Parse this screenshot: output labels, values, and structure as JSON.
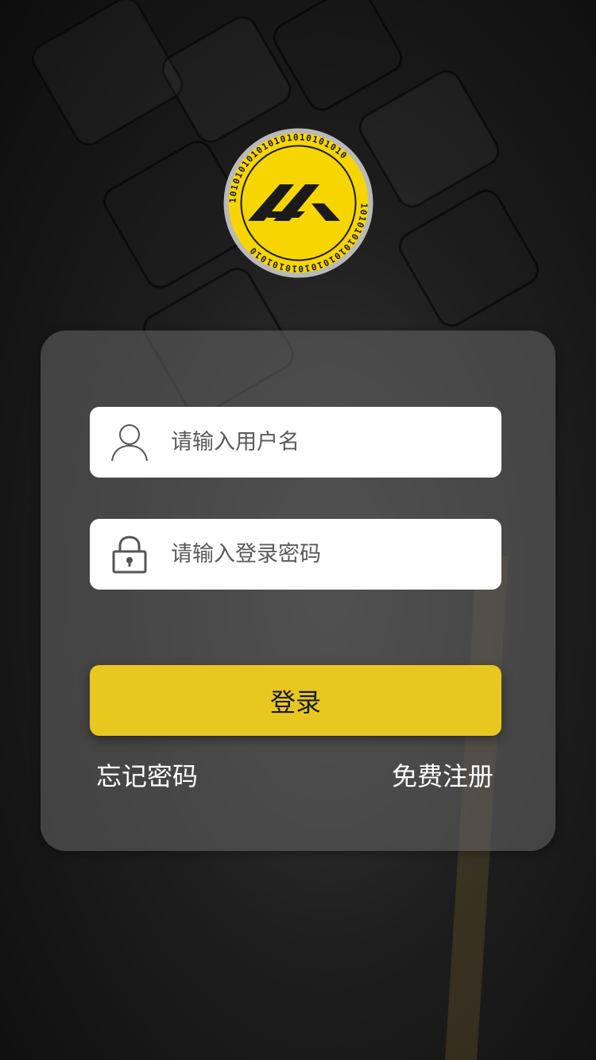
{
  "logo": {
    "letters": "AK",
    "ring_text": "101010101010101010101010",
    "colors": {
      "face": "#f7d600",
      "rim": "#b9b9b9",
      "ink": "#1a1a1a"
    }
  },
  "form": {
    "username": {
      "icon": "user-icon",
      "placeholder": "请输入用户名",
      "value": ""
    },
    "password": {
      "icon": "lock-icon",
      "placeholder": "请输入登录密码",
      "value": ""
    },
    "login_label": "登录"
  },
  "links": {
    "forgot_password": "忘记密码",
    "register": "免费注册"
  },
  "colors": {
    "accent": "#e8c81f",
    "card": "rgba(95,95,95,0.62)",
    "background": "#111111"
  }
}
